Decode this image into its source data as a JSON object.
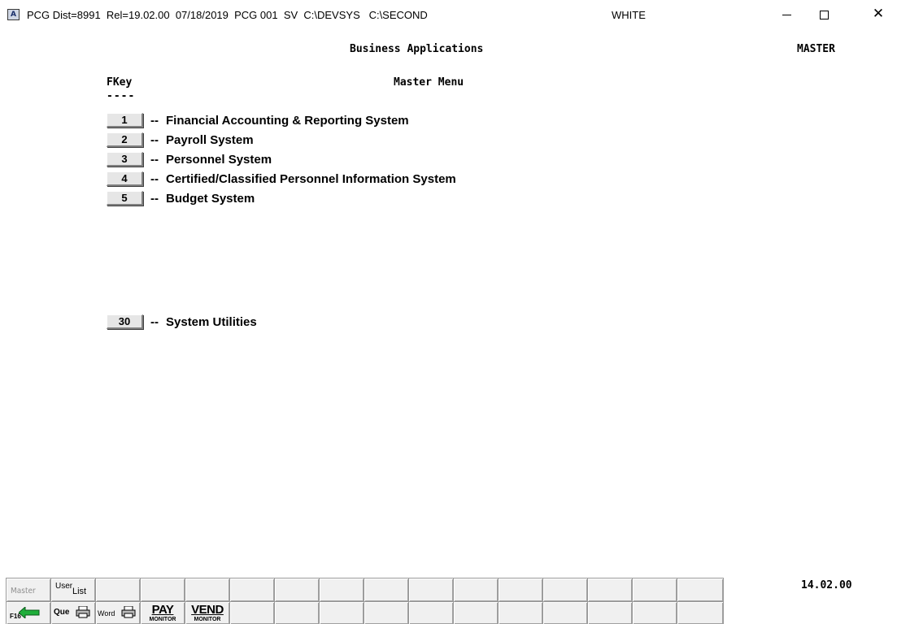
{
  "titlebar": {
    "text": "PCG Dist=8991  Rel=19.02.00  07/18/2019  PCG 001  SV  C:\\DEVSYS   C:\\SECOND",
    "user": "WHITE",
    "app_icon_letter": "A"
  },
  "screen": {
    "title": "Business Applications",
    "code": "MASTER",
    "fkey_header": "FKey",
    "fkey_underline": "----",
    "menu_title": "Master Menu",
    "clock": "14.02.00"
  },
  "menu": {
    "items": [
      {
        "key": "1",
        "label": "Financial Accounting & Reporting System"
      },
      {
        "key": "2",
        "label": "Payroll System"
      },
      {
        "key": "3",
        "label": "Personnel System"
      },
      {
        "key": "4",
        "label": "Certified/Classified Personnel Information System"
      },
      {
        "key": "5",
        "label": "Budget System"
      },
      {
        "key": "30",
        "label": "System Utilities"
      }
    ],
    "separator": "--"
  },
  "toolbar": {
    "master": "Master",
    "user": "User",
    "list": "List",
    "f16": "F16",
    "que": "Que",
    "word": "Word",
    "pay": "PAY",
    "pay_sub": "MONITOR",
    "vend": "VEND",
    "vend_sub": "MONITOR",
    "accent_green": "#1fae3a"
  }
}
